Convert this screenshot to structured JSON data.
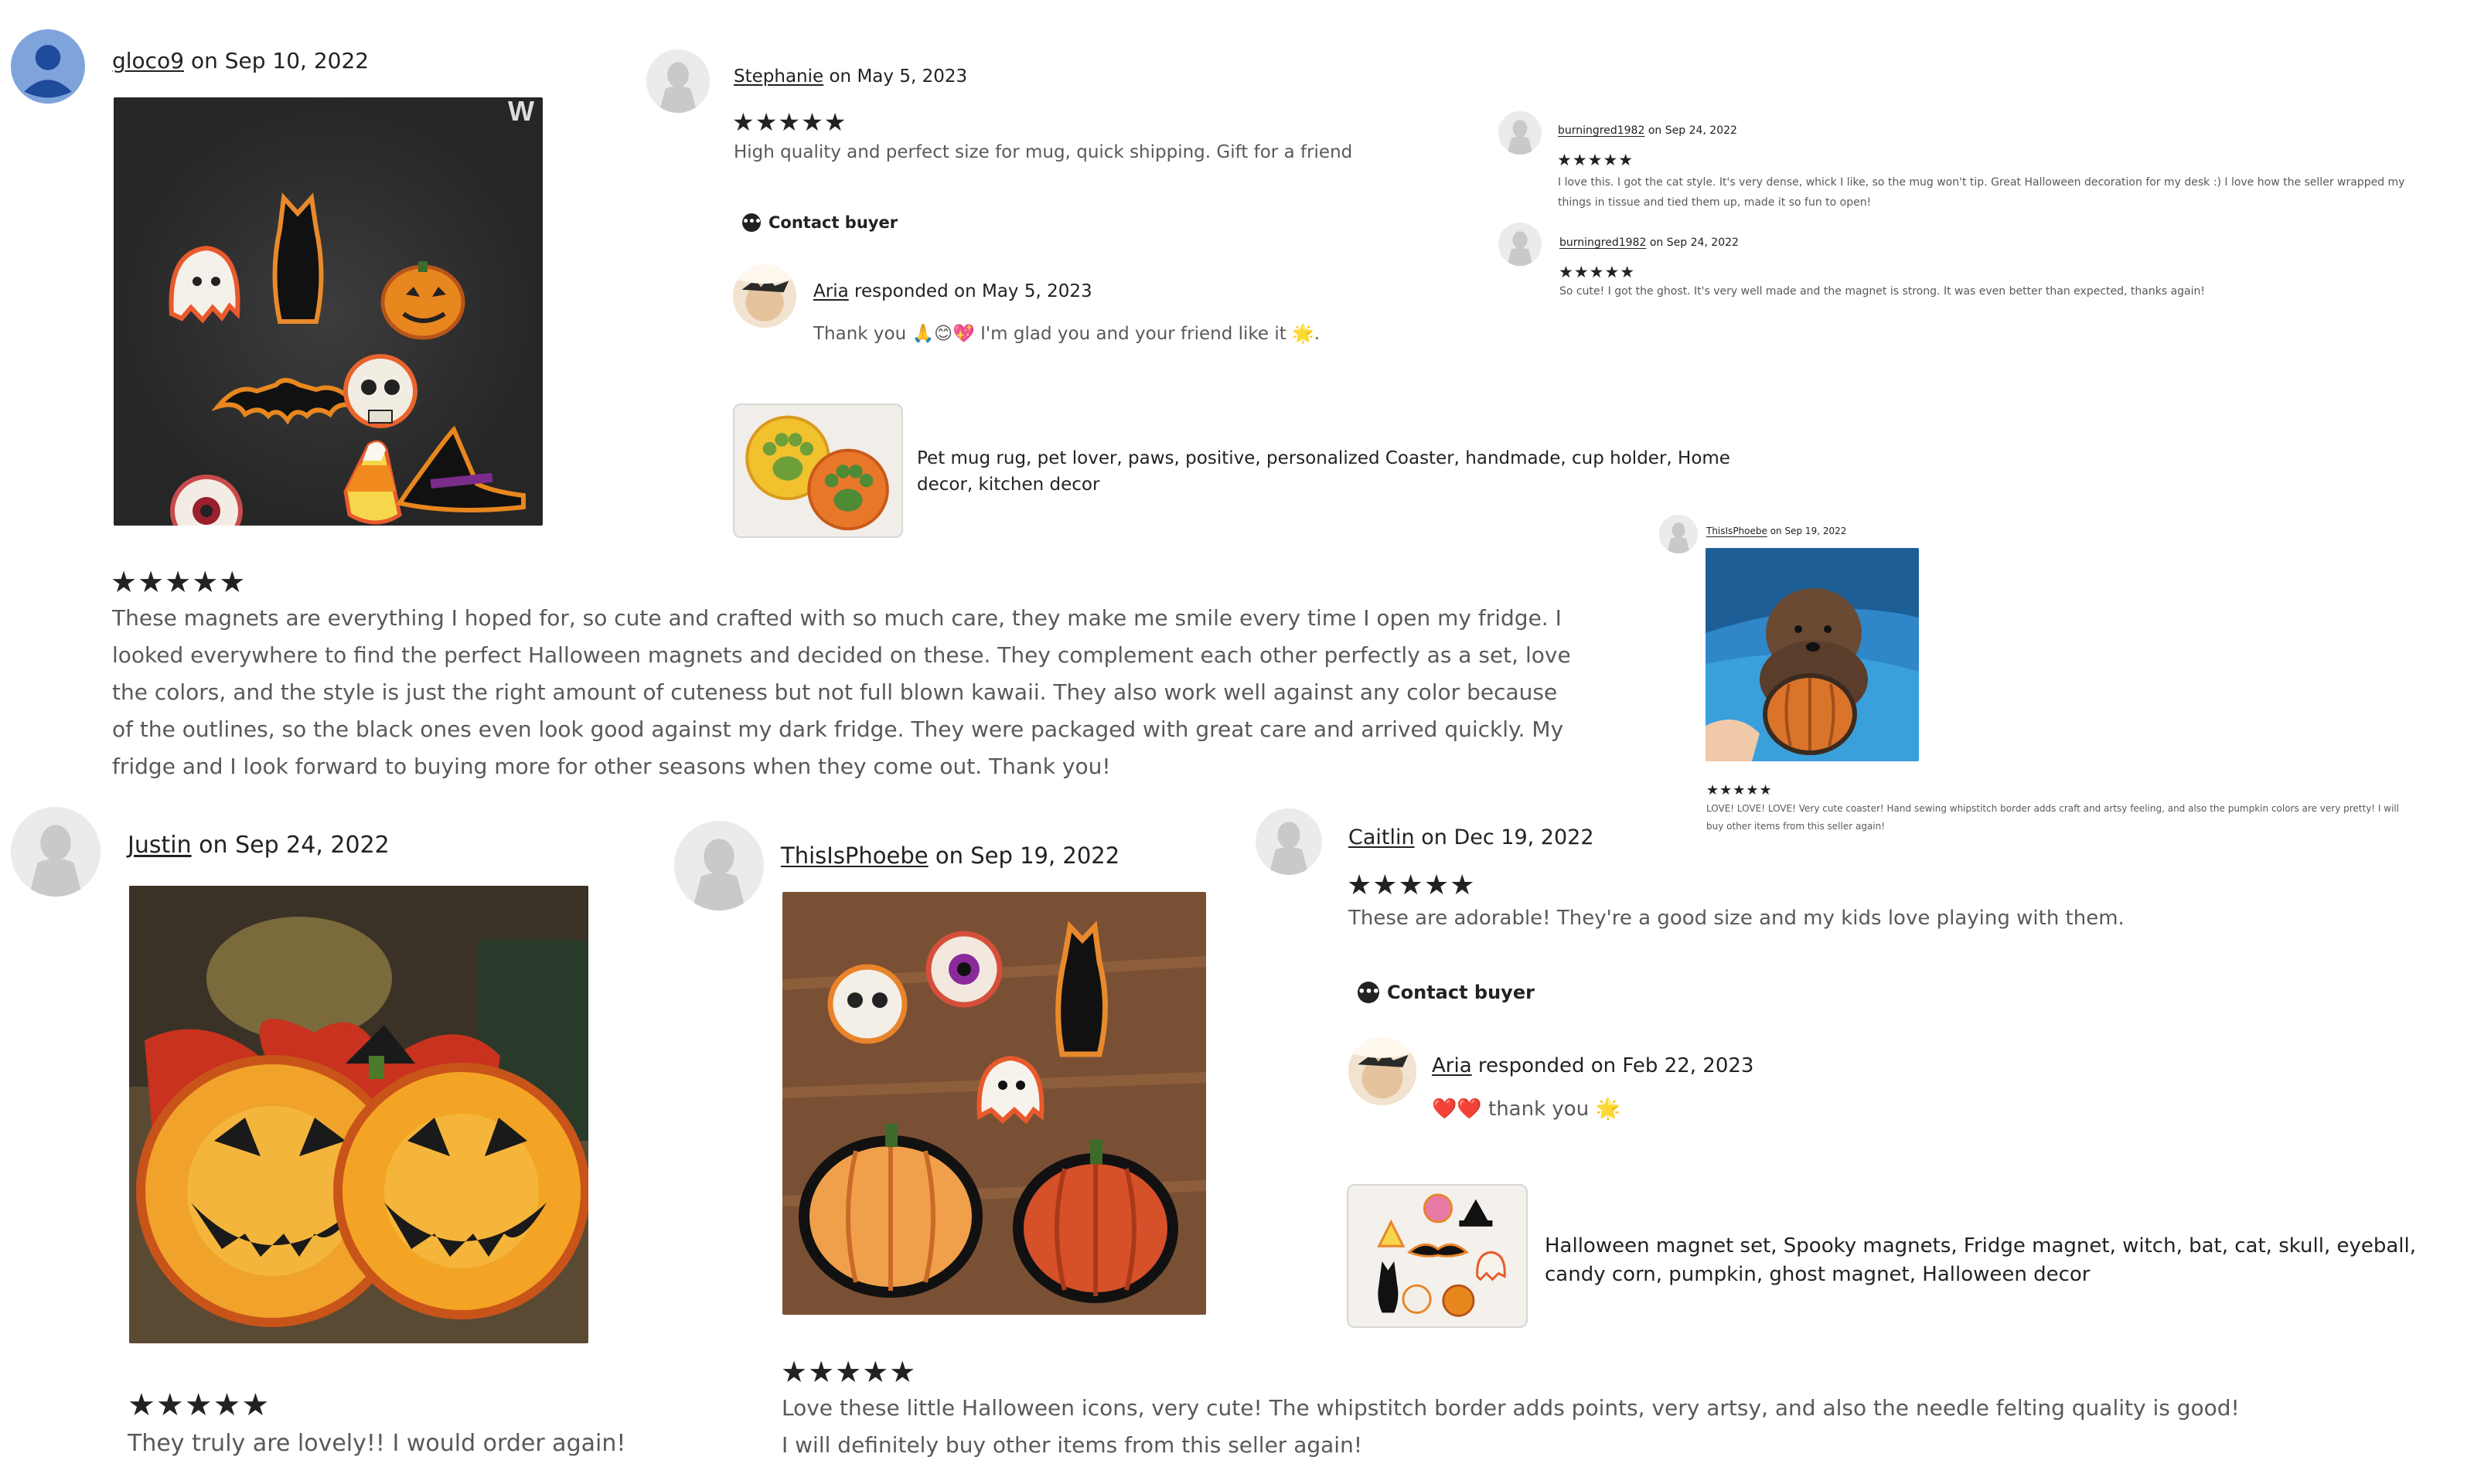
{
  "review1": {
    "user": "gloco9",
    "date_prefix": "on",
    "date": "Sep 10, 2022",
    "stars": "★★★★★",
    "text": "These magnets are everything I hoped for, so cute and crafted with so much care, they make me smile every time I open my fridge. I looked everywhere to find the perfect Halloween magnets and decided on these. They complement each other perfectly as a set, love the colors, and the style is just the right amount of cuteness but not full blown kawaii. They also work well against any color because of the outlines, so the black ones even look good against my dark fridge. They were packaged with great care and arrived quickly. My fridge and I look forward to buying more for other seasons when they come out. Thank you!",
    "photo_watermark": "W"
  },
  "review2": {
    "user": "Stephanie",
    "date_prefix": "on",
    "date": "May 5, 2023",
    "stars": "★★★★★",
    "text": "High quality and perfect size for mug, quick shipping. Gift for a friend",
    "contact": "Contact buyer",
    "response": {
      "seller": "Aria",
      "responded": "responded on",
      "date": "May 5, 2023",
      "text": "Thank you 🙏😊💖 I'm glad you and your friend like it 🌟."
    },
    "product": {
      "title": "Pet mug rug, pet lover, paws, positive, personalized Coaster, handmade, cup holder, Home decor, kitchen decor"
    }
  },
  "review3": {
    "user": "burningred1982",
    "date_prefix": "on",
    "date": "Sep 24, 2022",
    "stars": "★★★★★",
    "text": "I love this. I got the cat style. It's very dense, whick I like, so the mug won't tip. Great Halloween decoration for my desk :) I love how the seller wrapped my things in tissue and tied them up, made it so fun to open!"
  },
  "review4": {
    "user": "burningred1982",
    "date_prefix": "on",
    "date": "Sep 24, 2022",
    "stars": "★★★★★",
    "text": "So cute! I got the ghost. It's very well made and the magnet is strong. It was even better than expected, thanks again!"
  },
  "review5": {
    "user": "ThisIsPhoebe",
    "date_prefix": "on",
    "date": "Sep 19, 2022",
    "stars": "★★★★★",
    "text": "LOVE! LOVE! LOVE! Very cute coaster! Hand sewing whipstitch border adds craft and artsy feeling, and also the pumpkin colors are very pretty! I will buy other items from this seller again!"
  },
  "review6": {
    "user": "Justin",
    "date_prefix": "on",
    "date": "Sep 24, 2022",
    "stars": "★★★★★",
    "text": "They truly are lovely!! I would order again!"
  },
  "review7": {
    "user": "ThisIsPhoebe",
    "date_prefix": "on",
    "date": "Sep 19, 2022",
    "stars": "★★★★★",
    "text": "Love these little Halloween icons, very cute! The whipstitch border adds points, very artsy, and also the needle felting quality is good! I will definitely buy other items from this seller again!"
  },
  "review8": {
    "user": "Caitlin",
    "date_prefix": "on",
    "date": "Dec 19, 2022",
    "stars": "★★★★★",
    "text": "These are adorable! They're a good size and my kids love playing with them.",
    "contact": "Contact buyer",
    "response": {
      "seller": "Aria",
      "responded": "responded on",
      "date": "Feb 22, 2023",
      "text": "❤️❤️ thank you 🌟"
    },
    "product": {
      "title": "Halloween magnet set, Spooky magnets, Fridge magnet, witch, bat, cat, skull, eyeball, candy corn, pumpkin, ghost magnet, Halloween decor"
    }
  },
  "colors": {
    "text": "#222222",
    "muted": "#595959",
    "avatar_blue": "#7fa4dc",
    "avatar_gray": "#e9e9e9"
  }
}
